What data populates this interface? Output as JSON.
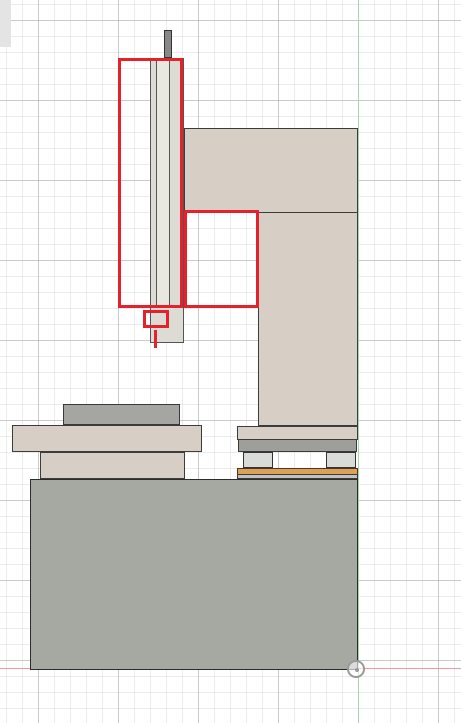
{
  "app": {
    "view": "cad-viewport-front"
  },
  "colors": {
    "grid_major": "#b0b0b0",
    "grid_minor": "#d8d8d8",
    "axis_x": "#ef9a9a",
    "axis_y": "#a5d6a7",
    "frame": "#d7cfc6",
    "base": "#a6a8a2",
    "selection": "#e5212b",
    "plank": "#dca05a"
  },
  "icons": {
    "origin": "origin-marker-icon"
  }
}
